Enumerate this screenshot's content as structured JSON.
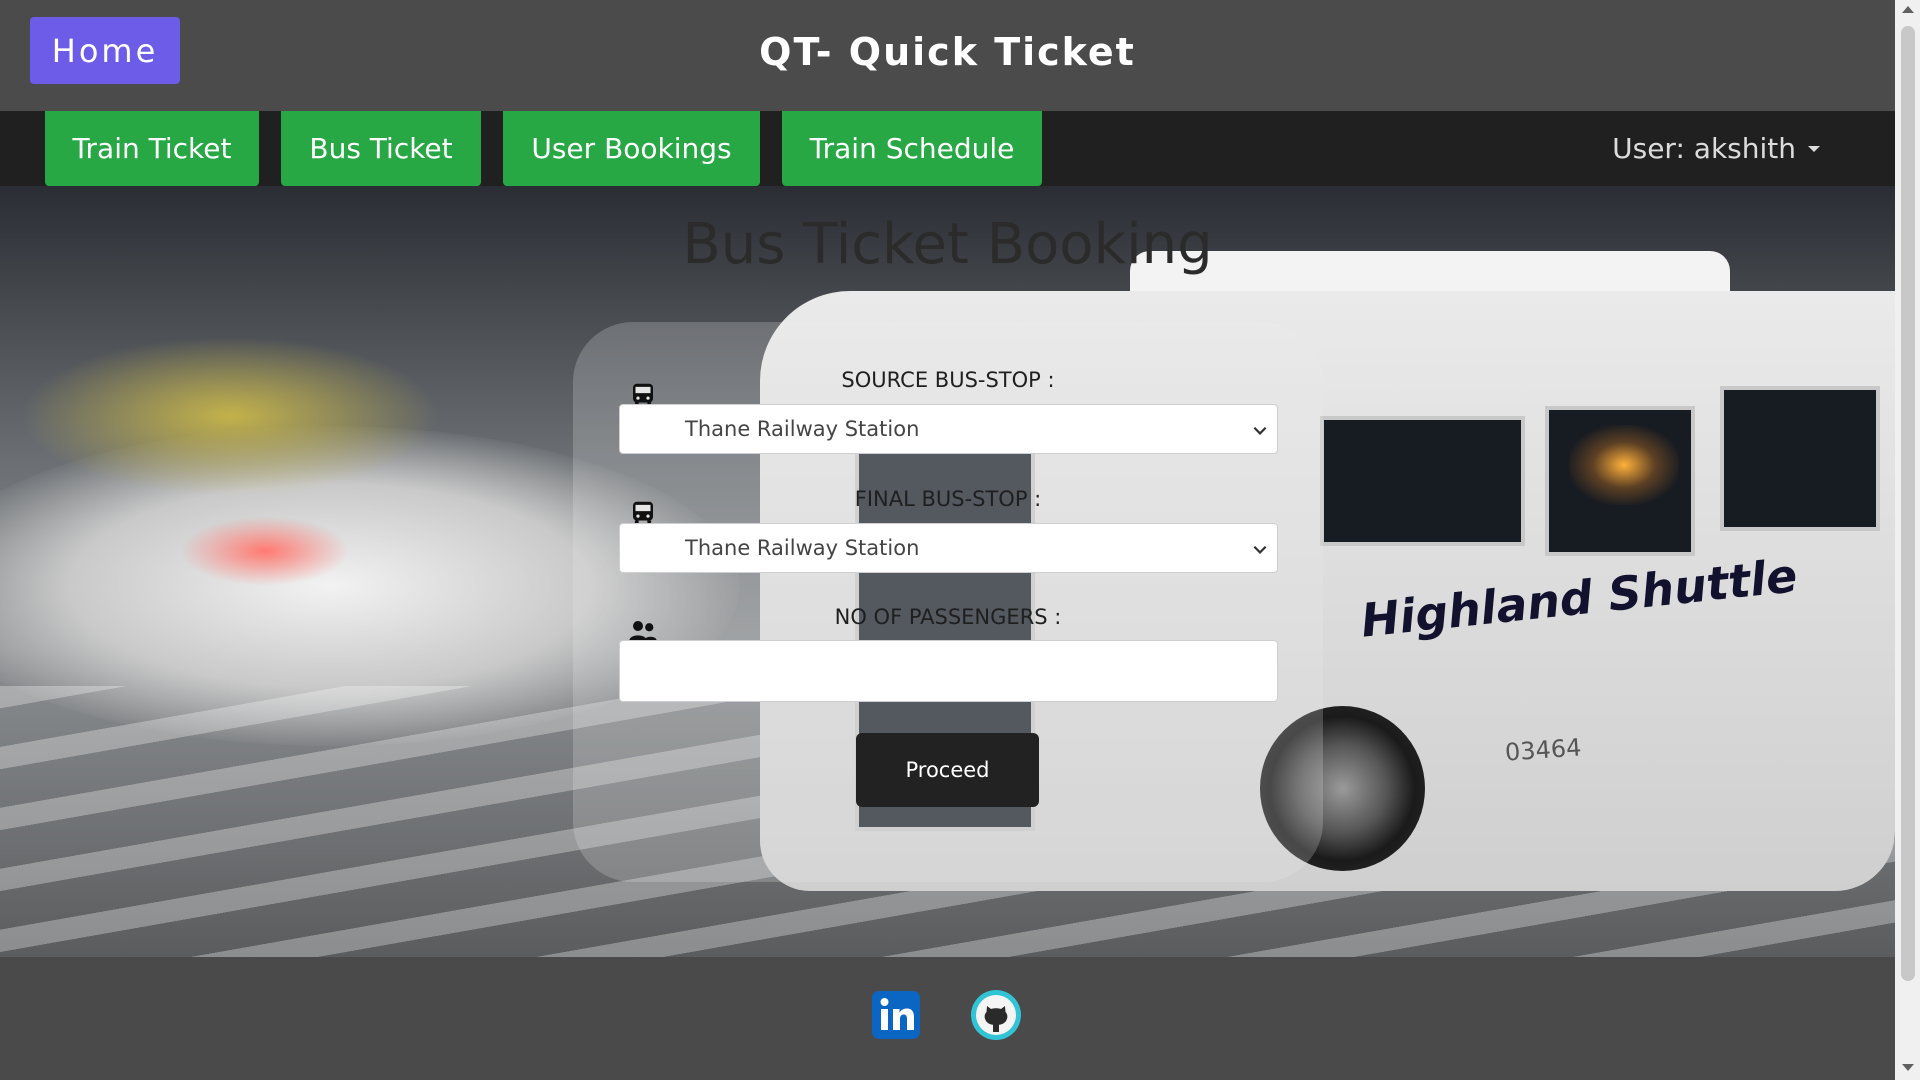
{
  "header": {
    "home_label": "Home",
    "title": "QT- Quick Ticket"
  },
  "nav": {
    "items": [
      {
        "label": "Train Ticket"
      },
      {
        "label": "Bus Ticket"
      },
      {
        "label": "User Bookings"
      },
      {
        "label": "Train Schedule"
      }
    ],
    "user_label": "User: akshith"
  },
  "background": {
    "bus_text": "Highland Shuttle",
    "bus_number": "03464"
  },
  "booking": {
    "heading": "Bus Ticket Booking",
    "source_label": "SOURCE BUS-STOP :",
    "source_value": "Thane Railway Station",
    "final_label": "FINAL BUS-STOP :",
    "final_value": "Thane Railway Station",
    "passengers_label": "NO OF PASSENGERS :",
    "passengers_value": "",
    "proceed_label": "Proceed"
  },
  "icons": {
    "source": "bus-icon",
    "final": "bus-icon",
    "passengers": "users-icon"
  },
  "footer": {
    "social": [
      "linkedin-icon",
      "github-icon"
    ]
  },
  "colors": {
    "home_button": "#6c5ce7",
    "nav_button": "#28a745",
    "navbar_bg": "#202020",
    "proceed_bg": "#222222"
  }
}
